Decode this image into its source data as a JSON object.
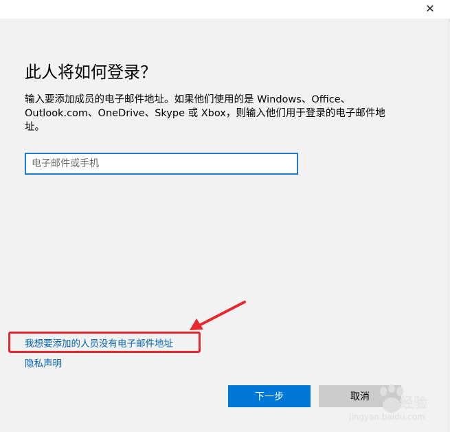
{
  "titlebar": {
    "close_glyph": "✕"
  },
  "dialog": {
    "heading": "此人将如何登录？",
    "description": "输入要添加成员的电子邮件地址。如果他们使用的是 Windows、Office、Outlook.com、OneDrive、Skype 或 Xbox，则输入他们用于登录的电子邮件地址。",
    "email_input": {
      "value": "",
      "placeholder": "电子邮件或手机"
    },
    "link_no_email": "我想要添加的人员没有电子邮件地址",
    "link_privacy": "隐私声明",
    "next_button": "下一步",
    "cancel_button": "取消"
  },
  "annotation": {
    "highlight_color": "#e8262d"
  },
  "watermark": {
    "brand": "经验",
    "url": "jingyan.baidu.com"
  },
  "colors": {
    "accent": "#0078d7",
    "link": "#0063b1",
    "input_border": "#1d7dd0",
    "background": "#f2f2f2"
  }
}
